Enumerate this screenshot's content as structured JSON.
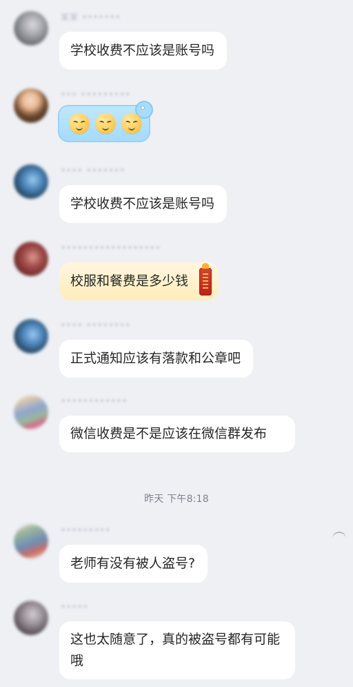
{
  "messages": [
    {
      "name": "某某 •••••••",
      "text": "学校收费不应该是账号吗"
    },
    {
      "name": "••• •••••••••",
      "emoji": [
        "smiling-face-icon",
        "smiling-face-icon",
        "smiling-face-icon"
      ]
    },
    {
      "name": "•••• •••••••",
      "text": "学校收费不应该是账号吗"
    },
    {
      "name": "••••••••••••••••••",
      "text": "校服和餐费是多少钱"
    },
    {
      "name": "•••• ••••••••",
      "text": "正式通知应该有落款和公章吧"
    },
    {
      "name": "••••••••••••",
      "text": "微信收费是不是应该在微信群发布"
    },
    {
      "name": "•••••••••",
      "text": "老师有没有被人盗号?"
    },
    {
      "name": "•••••",
      "text": "这也太随意了，真的被盗号都有可能哦"
    }
  ],
  "timestamp": "昨天 下午8:18",
  "colors": {
    "background": "#eef0f4",
    "bubble": "#ffffff",
    "gold_bubble": "#fff0c8",
    "blue_bubble": "#b4e0ff",
    "text": "#262626",
    "timestamp": "#7d828a"
  }
}
